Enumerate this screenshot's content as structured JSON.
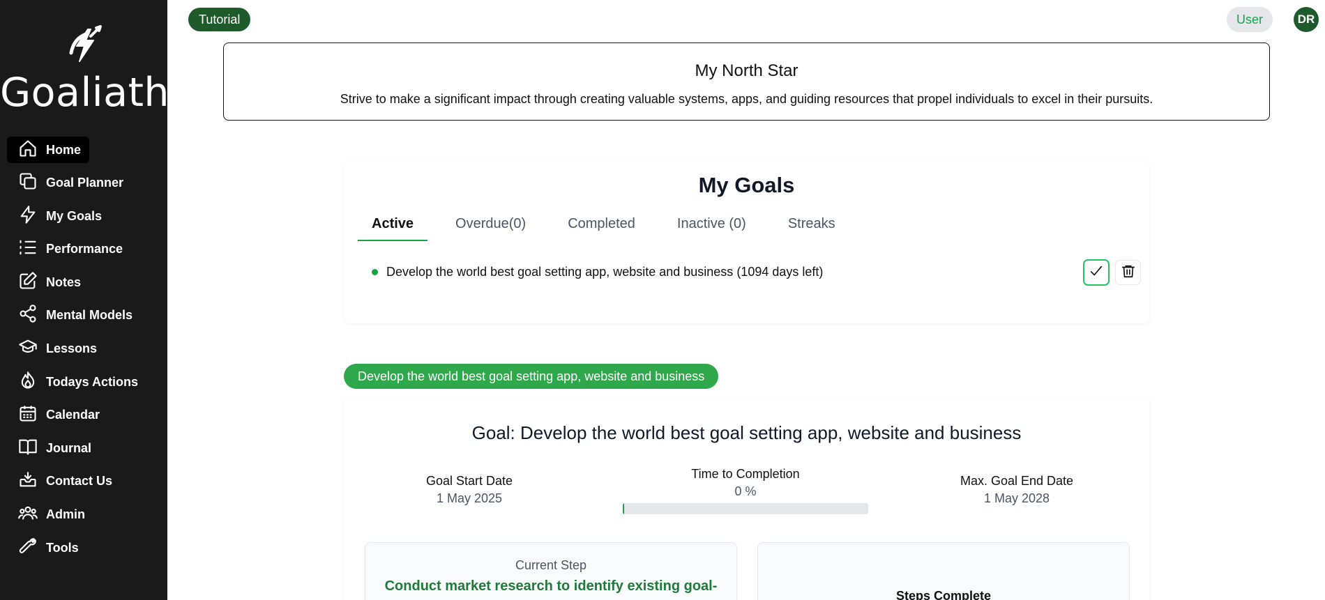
{
  "app": {
    "brand": "Goaliath"
  },
  "sidebar": {
    "items": [
      {
        "label": "Home",
        "icon": "home-icon",
        "active": true
      },
      {
        "label": "Goal Planner",
        "icon": "copy-icon"
      },
      {
        "label": "My Goals",
        "icon": "lightning-icon"
      },
      {
        "label": "Performance",
        "icon": "list-icon"
      },
      {
        "label": "Notes",
        "icon": "edit-icon"
      },
      {
        "label": "Mental Models",
        "icon": "share-icon"
      },
      {
        "label": "Lessons",
        "icon": "graduation-cap-icon"
      },
      {
        "label": "Todays Actions",
        "icon": "flame-icon"
      },
      {
        "label": "Calendar",
        "icon": "calendar-icon"
      },
      {
        "label": "Journal",
        "icon": "book-icon"
      },
      {
        "label": "Contact Us",
        "icon": "inbox-icon"
      },
      {
        "label": "Admin",
        "icon": "users-icon"
      },
      {
        "label": "Tools",
        "icon": "wrench-icon"
      }
    ]
  },
  "header": {
    "tutorial_label": "Tutorial",
    "user_label": "User",
    "avatar_initials": "DR"
  },
  "north_star": {
    "title": "My North Star",
    "text": "Strive to make a significant impact through creating valuable systems, apps, and guiding resources that propel individuals to excel in their pursuits."
  },
  "goals": {
    "title": "My Goals",
    "tabs": [
      {
        "label": "Active",
        "active": true
      },
      {
        "label": "Overdue(0)"
      },
      {
        "label": "Completed"
      },
      {
        "label": "Inactive (0)"
      },
      {
        "label": "Streaks"
      }
    ],
    "items": [
      {
        "text": "Develop the world best goal setting app, website and business (1094 days left)",
        "status_color": "#16a34a"
      }
    ]
  },
  "goal_detail": {
    "pill_label": "Develop the world best goal setting app, website and business",
    "title": "Goal: Develop the world best goal setting app, website and business",
    "start_label": "Goal Start Date",
    "start_value": "1 May 2025",
    "completion_label": "Time to Completion",
    "completion_value": "0 %",
    "completion_fraction": 0,
    "end_label": "Max. Goal End Date",
    "end_value": "1 May 2028",
    "current_step_label": "Current Step",
    "current_step_text": "Conduct market research to identify existing goal-",
    "steps_complete_label": "Steps Complete"
  },
  "colors": {
    "sidebar_bg": "#1a1a1a",
    "brand_green": "#1f5a2b",
    "accent_green": "#16a34a",
    "pill_green": "#2ea84a"
  }
}
